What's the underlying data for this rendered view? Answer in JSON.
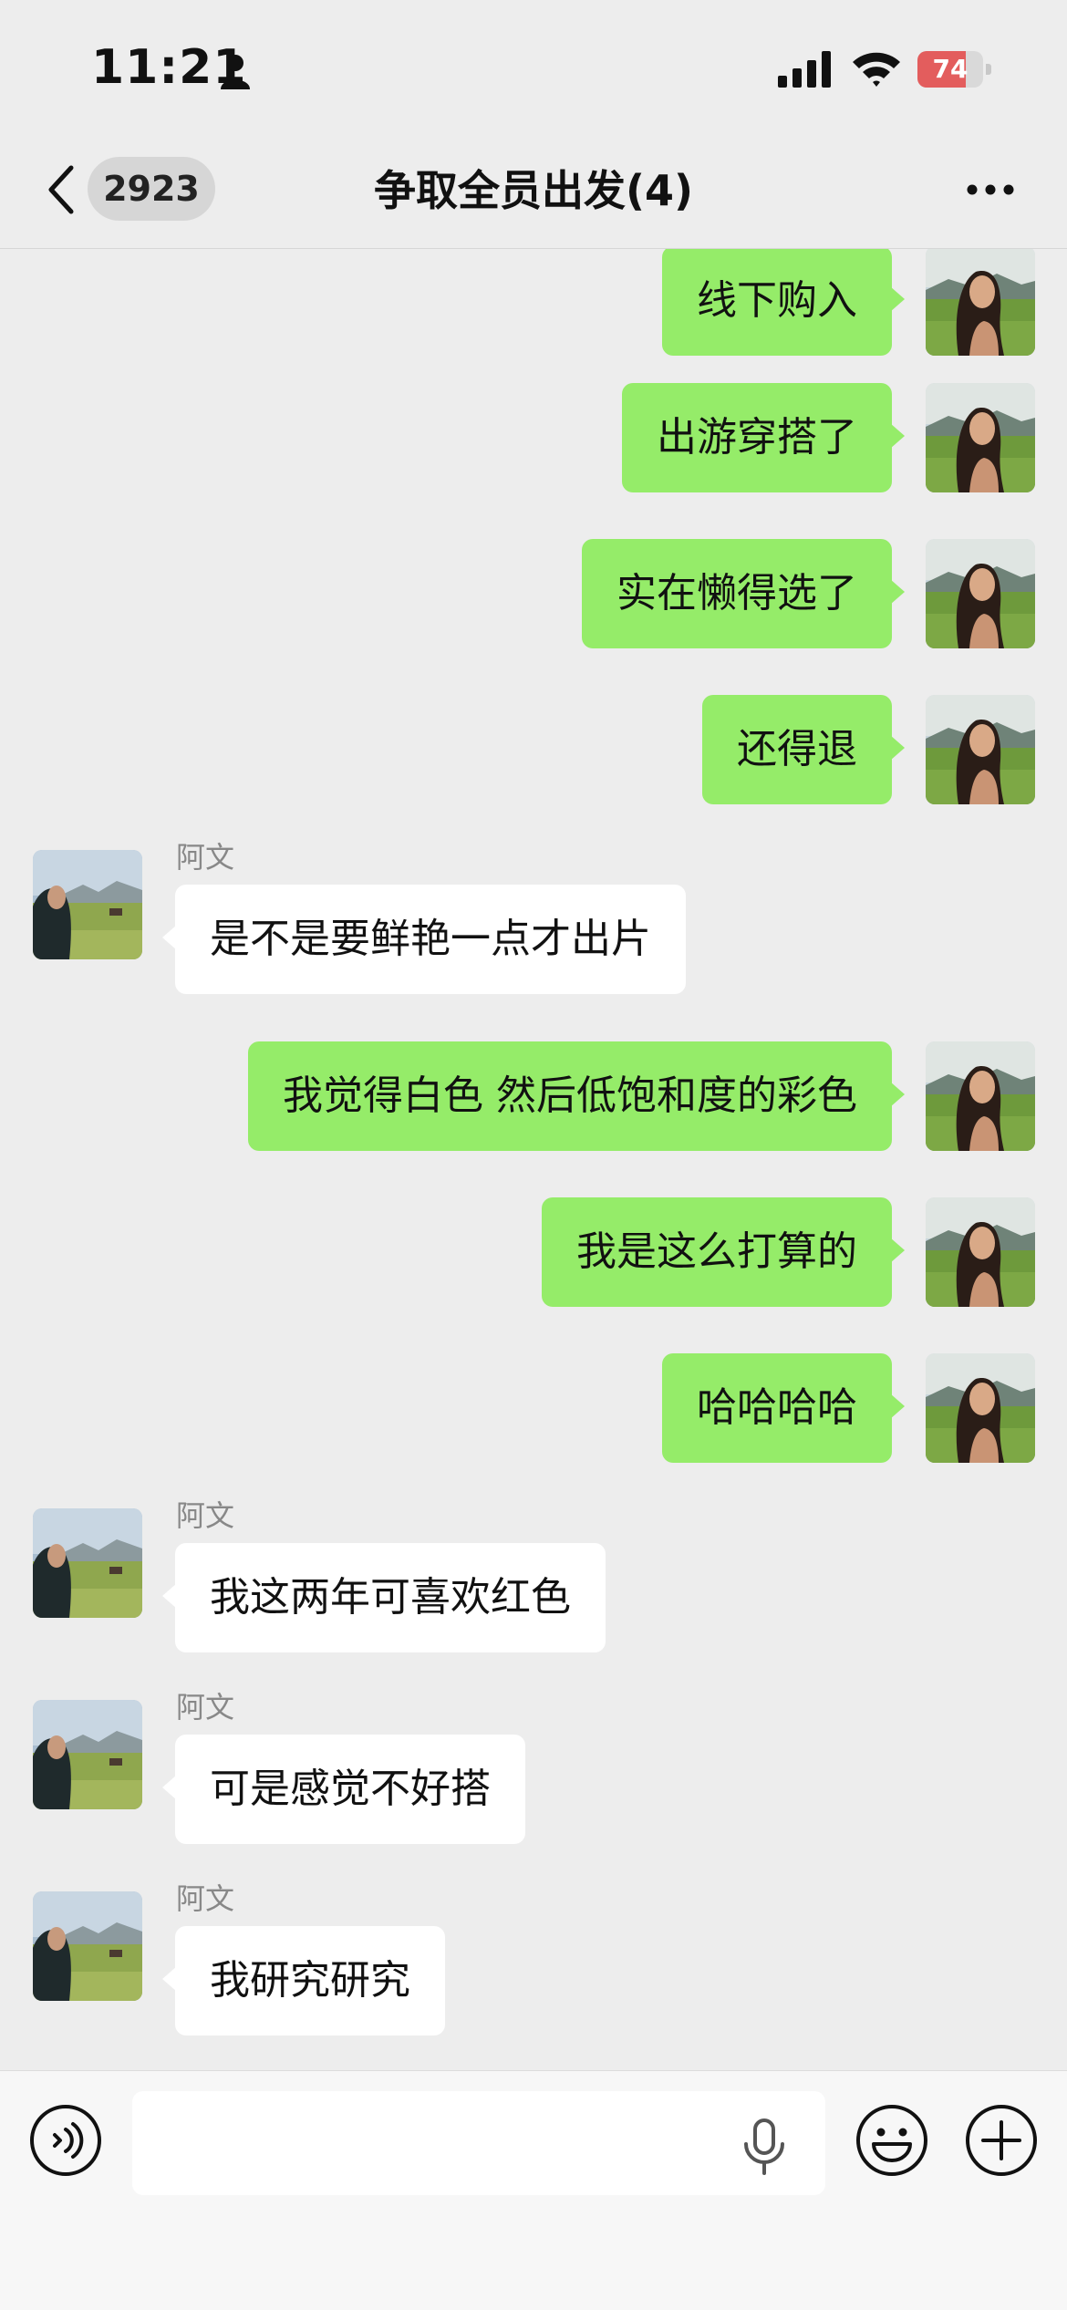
{
  "status_bar": {
    "time": "11:21",
    "battery": "74",
    "battery_level": 0.74,
    "person_icon": "person-icon",
    "signal_icon": "cellular-signal-icon",
    "wifi_icon": "wifi-icon"
  },
  "nav": {
    "unread_count": "2923",
    "title": "争取全员出发(4)",
    "back_icon": "chevron-left-icon",
    "more_icon": "ellipsis-icon"
  },
  "messages": [
    {
      "from": "self",
      "text": "线下购入"
    },
    {
      "from": "self",
      "text": "出游穿搭了"
    },
    {
      "from": "self",
      "text": "实在懒得选了"
    },
    {
      "from": "self",
      "text": "还得退"
    },
    {
      "from": "other",
      "sender": "阿文",
      "text": "是不是要鲜艳一点才出片"
    },
    {
      "from": "self",
      "text": "我觉得白色 然后低饱和度的彩色"
    },
    {
      "from": "self",
      "text": "我是这么打算的"
    },
    {
      "from": "self",
      "text": "哈哈哈哈"
    },
    {
      "from": "other",
      "sender": "阿文",
      "text": "我这两年可喜欢红色"
    },
    {
      "from": "other",
      "sender": "阿文",
      "text": "可是感觉不好搭"
    },
    {
      "from": "other",
      "sender": "阿文",
      "text": "我研究研究"
    }
  ],
  "input_bar": {
    "input_value": "",
    "voice_icon": "voice-mode-icon",
    "mic_icon": "microphone-icon",
    "emoji_icon": "emoji-icon",
    "plus_icon": "plus-icon"
  },
  "colors": {
    "background": "#ededed",
    "self_bubble": "#95ec69",
    "other_bubble": "#ffffff",
    "battery_low": "#e35d5d"
  }
}
